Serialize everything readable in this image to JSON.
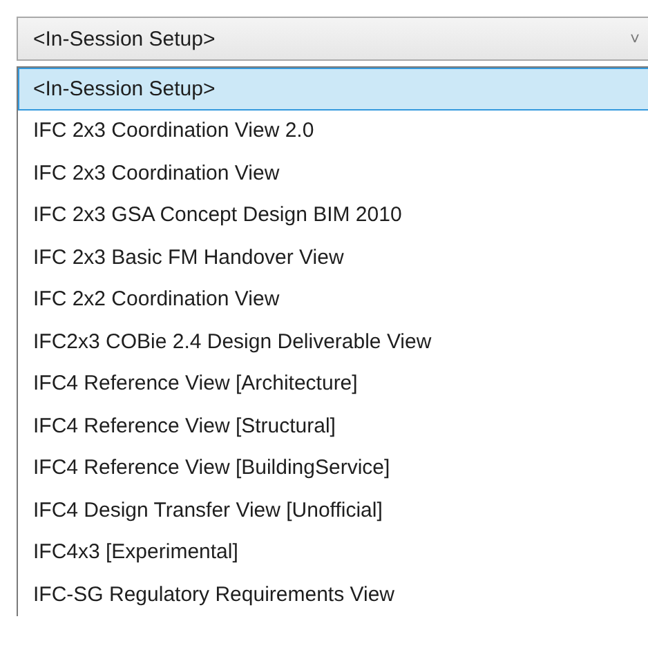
{
  "combo": {
    "value": "<In-Session Setup>",
    "arrow": "˅"
  },
  "options": [
    {
      "label": "<In-Session Setup>",
      "selected": true
    },
    {
      "label": "IFC 2x3 Coordination View 2.0",
      "selected": false
    },
    {
      "label": "IFC 2x3 Coordination View",
      "selected": false
    },
    {
      "label": "IFC 2x3 GSA Concept Design BIM 2010",
      "selected": false
    },
    {
      "label": "IFC 2x3 Basic FM Handover View",
      "selected": false
    },
    {
      "label": "IFC 2x2 Coordination View",
      "selected": false
    },
    {
      "label": "IFC2x3 COBie 2.4 Design Deliverable View",
      "selected": false
    },
    {
      "label": "IFC4 Reference View [Architecture]",
      "selected": false
    },
    {
      "label": "IFC4 Reference View [Structural]",
      "selected": false
    },
    {
      "label": "IFC4 Reference View [BuildingService]",
      "selected": false
    },
    {
      "label": "IFC4 Design Transfer View [Unofficial]",
      "selected": false
    },
    {
      "label": "IFC4x3 [Experimental]",
      "selected": false
    },
    {
      "label": "IFC-SG Regulatory Requirements View",
      "selected": false
    }
  ]
}
